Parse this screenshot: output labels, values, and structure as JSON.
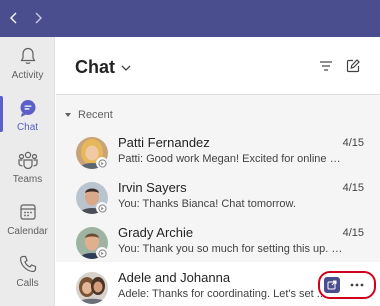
{
  "topbar": {
    "back_icon": "chevron-left-icon",
    "forward_icon": "chevron-right-icon",
    "color": "#4b4e8e"
  },
  "rail": {
    "items": [
      {
        "label": "Activity",
        "icon": "bell-icon",
        "active": false
      },
      {
        "label": "Chat",
        "icon": "chat-icon",
        "active": true
      },
      {
        "label": "Teams",
        "icon": "teams-icon",
        "active": false
      },
      {
        "label": "Calendar",
        "icon": "calendar-icon",
        "active": false
      },
      {
        "label": "Calls",
        "icon": "phone-icon",
        "active": false
      }
    ]
  },
  "header": {
    "title": "Chat",
    "filter_icon": "filter-icon",
    "compose_icon": "compose-icon"
  },
  "section": {
    "label": "Recent"
  },
  "chats": [
    {
      "name": "Patti Fernandez",
      "preview": "Patti: Good work Megan! Excited for online yoga!...",
      "date": "4/15"
    },
    {
      "name": "Irvin Sayers",
      "preview": "You: Thanks Bianca! Chat tomorrow.",
      "date": "4/15"
    },
    {
      "name": "Grady Archie",
      "preview": "You: Thank you so much for setting this up. I app...",
      "date": "4/15"
    },
    {
      "name": "Adele and Johanna",
      "preview": "Adele: Thanks for coordinating. Let's set ...",
      "date": ""
    }
  ],
  "colors": {
    "accent": "#5b5fc7",
    "highlight": "#d1001f",
    "brand": "#4b4e8e"
  }
}
